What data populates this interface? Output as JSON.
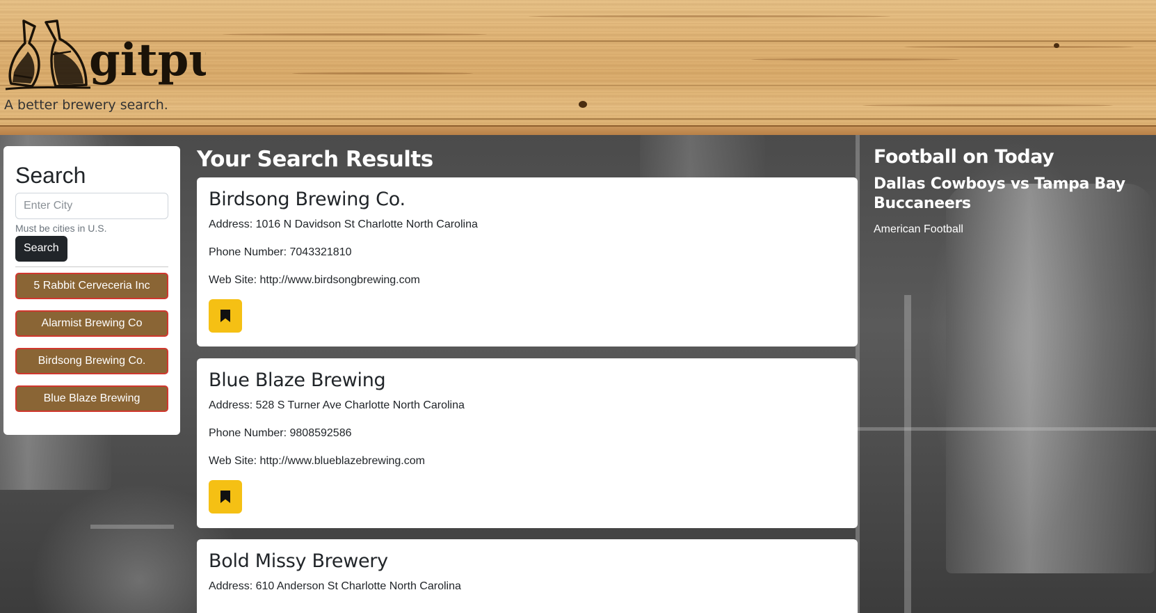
{
  "header": {
    "brand": "gitpub",
    "tagline": "A better brewery search."
  },
  "search": {
    "title": "Search",
    "placeholder": "Enter City",
    "hint": "Must be cities in U.S.",
    "button_label": "Search",
    "saved": [
      {
        "label": "5 Rabbit Cerveceria Inc"
      },
      {
        "label": "Alarmist Brewing Co"
      },
      {
        "label": "Birdsong Brewing Co."
      },
      {
        "label": "Blue Blaze Brewing"
      }
    ]
  },
  "results": {
    "title": "Your Search Results",
    "items": [
      {
        "name": "Birdsong Brewing Co.",
        "address": "Address: 1016 N Davidson St Charlotte North Carolina",
        "phone": "Phone Number: 7043321810",
        "website": "Web Site: http://www.birdsongbrewing.com"
      },
      {
        "name": "Blue Blaze Brewing",
        "address": "Address: 528 S Turner Ave Charlotte North Carolina",
        "phone": "Phone Number: 9808592586",
        "website": "Web Site: http://www.blueblazebrewing.com"
      },
      {
        "name": "Bold Missy Brewery",
        "address": "Address: 610 Anderson St Charlotte North Carolina"
      }
    ]
  },
  "football": {
    "title": "Football on Today",
    "match": "Dallas Cowboys vs Tampa Bay Buccaneers",
    "sport": "American Football"
  },
  "colors": {
    "saved_button_bg": "#8a6535",
    "saved_button_border": "#d0372e",
    "bookmark_bg": "#f5c014",
    "search_button_bg": "#212529"
  },
  "icons": {
    "logo": "beer-bottles-logo",
    "bookmark": "bookmark-icon"
  }
}
